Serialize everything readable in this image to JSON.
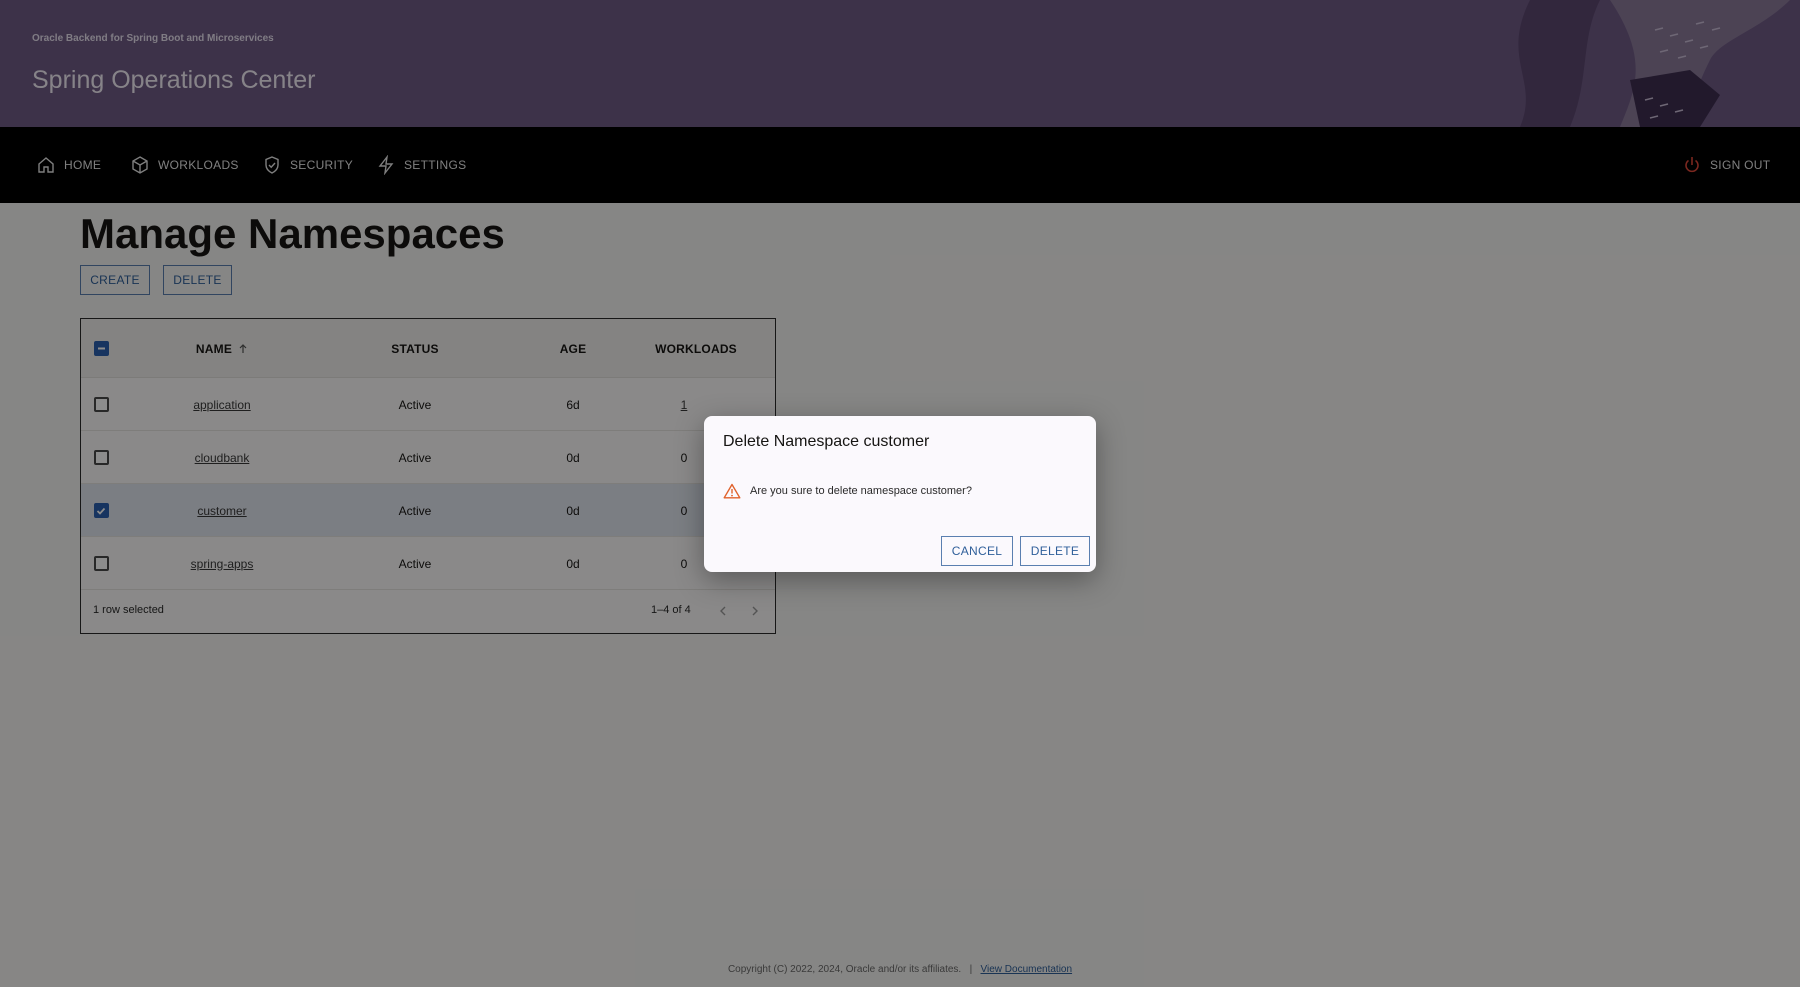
{
  "header": {
    "subtitle": "Oracle Backend for Spring Boot and Microservices",
    "title": "Spring Operations Center"
  },
  "nav": {
    "items": [
      {
        "label": "HOME",
        "icon": "home-icon"
      },
      {
        "label": "WORKLOADS",
        "icon": "cube-icon"
      },
      {
        "label": "SECURITY",
        "icon": "shield-check-icon"
      },
      {
        "label": "SETTINGS",
        "icon": "lightning-icon"
      }
    ],
    "signout_label": "SIGN OUT",
    "signout_icon": "power-icon"
  },
  "page": {
    "title": "Manage Namespaces",
    "create_label": "CREATE",
    "delete_label": "DELETE"
  },
  "table": {
    "columns": [
      "NAME",
      "STATUS",
      "AGE",
      "WORKLOADS"
    ],
    "sort_icon": "arrow-up-icon",
    "rows": [
      {
        "name": "application",
        "status": "Active",
        "age": "6d",
        "workloads": "1",
        "selected": false
      },
      {
        "name": "cloudbank",
        "status": "Active",
        "age": "0d",
        "workloads": "0",
        "selected": false
      },
      {
        "name": "customer",
        "status": "Active",
        "age": "0d",
        "workloads": "0",
        "selected": true
      },
      {
        "name": "spring-apps",
        "status": "Active",
        "age": "0d",
        "workloads": "0",
        "selected": false
      }
    ],
    "selection_text": "1 row selected",
    "pagination_text": "1–4 of 4"
  },
  "dialog": {
    "title": "Delete Namespace customer",
    "message": "Are you sure to delete namespace customer?",
    "cancel_label": "CANCEL",
    "delete_label": "DELETE",
    "warning_color": "#e0622c"
  },
  "footer": {
    "copyright": "Copyright (C) 2022, 2024, Oracle and/or its affiliates.",
    "separator": "|",
    "link_label": "View Documentation"
  },
  "colors": {
    "banner": "#6f5b86",
    "navbar": "#000000",
    "accent": "#2a5fb0",
    "signout_icon": "#e0483a"
  }
}
